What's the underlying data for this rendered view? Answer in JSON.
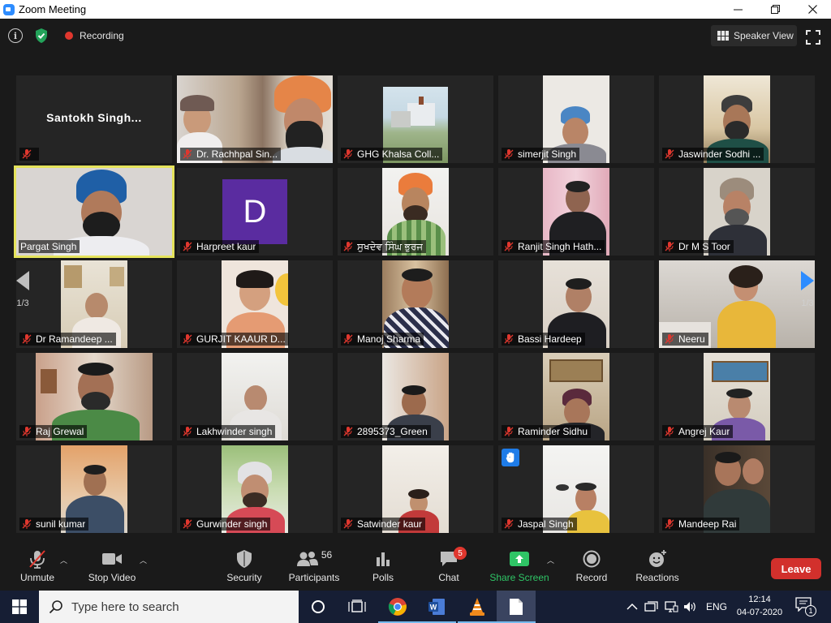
{
  "window": {
    "title": "Zoom Meeting",
    "minimize": "—",
    "maximize": "❐",
    "close": "✕"
  },
  "topbar": {
    "info_icon": "i",
    "recording_label": "Recording",
    "speaker_view_label": "Speaker View"
  },
  "participants": [
    {
      "name": "Santokh  Singh...",
      "display": "name-only"
    },
    {
      "name": "Dr. Rachhpal Sin..."
    },
    {
      "name": "GHG Khalsa Coll..."
    },
    {
      "name": "simerjit Singh"
    },
    {
      "name": "Jaswinder Sodhi ..."
    },
    {
      "name": "Pargat Singh",
      "active_speaker": true
    },
    {
      "name": "Harpreet kaur",
      "avatar_letter": "D"
    },
    {
      "name": "ਸੁਖਦੇਵ ਸਿੰਘ ਭੁਰਜ"
    },
    {
      "name": "Ranjit Singh Hath..."
    },
    {
      "name": "Dr M S Toor"
    },
    {
      "name": "Dr Ramandeep ..."
    },
    {
      "name": "GURJIT KAAUR D..."
    },
    {
      "name": "Manoj Sharma"
    },
    {
      "name": "Bassi Hardeep"
    },
    {
      "name": "Neeru"
    },
    {
      "name": "Raj Grewal"
    },
    {
      "name": "Lakhwinder singh"
    },
    {
      "name": "2895373_Green"
    },
    {
      "name": "Raminder Sidhu"
    },
    {
      "name": "Angrej Kaur"
    },
    {
      "name": "sunil kumar"
    },
    {
      "name": "Gurwinder singh"
    },
    {
      "name": "Satwinder kaur"
    },
    {
      "name": "Jaspal Singh",
      "hand_raised": true
    },
    {
      "name": "Mandeep Rai"
    }
  ],
  "pagination": {
    "left_label": "1/3",
    "right_label": "1/3"
  },
  "toolbar": {
    "unmute": "Unmute",
    "stop_video": "Stop Video",
    "security": "Security",
    "participants": "Participants",
    "participants_count": "56",
    "polls": "Polls",
    "chat": "Chat",
    "chat_badge": "5",
    "share_screen": "Share Screen",
    "record": "Record",
    "reactions": "Reactions",
    "leave": "Leave"
  },
  "taskbar": {
    "search_placeholder": "Type here to search",
    "language": "ENG",
    "time": "12:14",
    "date": "04-07-2020",
    "notification_count": "1"
  },
  "colors": {
    "active_speaker_border": "#e5e35b",
    "share_screen_green": "#2fc566",
    "leave_red": "#d2302c",
    "chat_badge_red": "#e0372e",
    "taskbar_bg": "#161e34",
    "avatar_purple": "#5a2ca0"
  }
}
